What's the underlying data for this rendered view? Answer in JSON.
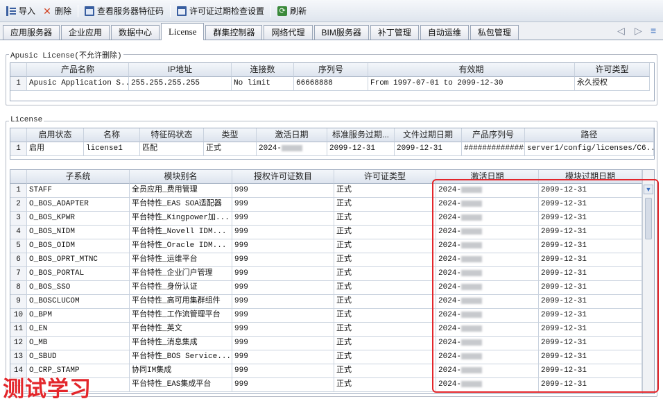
{
  "toolbar": {
    "import": "导入",
    "delete": "删除",
    "view_code": "查看服务器特征码",
    "license_check": "许可证过期检查设置",
    "refresh": "刷新"
  },
  "tabs": [
    "应用服务器",
    "企业应用",
    "数据中心",
    "License",
    "群集控制器",
    "网络代理",
    "BIM服务器",
    "补丁管理",
    "自动运维",
    "私包管理"
  ],
  "tab_nav": {
    "prev": "◁",
    "next": "▷",
    "menu": "≡"
  },
  "apusic": {
    "group_title": "Apusic License(不允许删除)",
    "headers": [
      "产品名称",
      "IP地址",
      "连接数",
      "序列号",
      "有效期",
      "许可类型"
    ],
    "rows": [
      [
        "1",
        "Apusic Application S...",
        "255.255.255.255",
        "No limit",
        "66668888",
        "From 1997-07-01  to 2099-12-30",
        "永久授权"
      ]
    ]
  },
  "license": {
    "group_title": "License",
    "headers": [
      "启用状态",
      "名称",
      "特征码状态",
      "类型",
      "激活日期",
      "标准服务过期...",
      "文件过期日期",
      "产品序列号",
      "路径"
    ],
    "rows": [
      [
        "1",
        "启用",
        "license1",
        "匹配",
        "正式",
        "2024-",
        "2099-12-31",
        "2099-12-31",
        "##############",
        "server1/config/licenses/C6..."
      ]
    ]
  },
  "modules": {
    "headers": [
      "子系统",
      "模块别名",
      "授权许可证数目",
      "许可证类型",
      "激活日期",
      "模块过期日期"
    ],
    "rows": [
      [
        "1",
        "STAFF",
        "全员应用_费用管理",
        "999",
        "正式",
        "2024-",
        "2099-12-31"
      ],
      [
        "2",
        "O_BOS_ADAPTER",
        "平台特性_EAS SOA适配器",
        "999",
        "正式",
        "2024-",
        "2099-12-31"
      ],
      [
        "3",
        "O_BOS_KPWR",
        "平台特性_Kingpower加...",
        "999",
        "正式",
        "2024-",
        "2099-12-31"
      ],
      [
        "4",
        "O_BOS_NIDM",
        "平台特性_Novell IDM...",
        "999",
        "正式",
        "2024-",
        "2099-12-31"
      ],
      [
        "5",
        "O_BOS_OIDM",
        "平台特性_Oracle IDM...",
        "999",
        "正式",
        "2024-",
        "2099-12-31"
      ],
      [
        "6",
        "O_BOS_OPRT_MTNC",
        "平台特性_运维平台",
        "999",
        "正式",
        "2024-",
        "2099-12-31"
      ],
      [
        "7",
        "O_BOS_PORTAL",
        "平台特性_企业门户管理",
        "999",
        "正式",
        "2024-",
        "2099-12-31"
      ],
      [
        "8",
        "O_BOS_SSO",
        "平台特性_身份认证",
        "999",
        "正式",
        "2024-",
        "2099-12-31"
      ],
      [
        "9",
        "O_BOSCLUCOM",
        "平台特性_高可用集群组件",
        "999",
        "正式",
        "2024-",
        "2099-12-31"
      ],
      [
        "10",
        "O_BPM",
        "平台特性_工作流管理平台",
        "999",
        "正式",
        "2024-",
        "2099-12-31"
      ],
      [
        "11",
        "O_EN",
        "平台特性_英文",
        "999",
        "正式",
        "2024-",
        "2099-12-31"
      ],
      [
        "12",
        "O_MB",
        "平台特性_消息集成",
        "999",
        "正式",
        "2024-",
        "2099-12-31"
      ],
      [
        "13",
        "O_SBUD",
        "平台特性_BOS Service...",
        "999",
        "正式",
        "2024-",
        "2099-12-31"
      ],
      [
        "14",
        "O_CRP_STAMP",
        "协同IM集成",
        "999",
        "正式",
        "2024-",
        "2099-12-31"
      ],
      [
        "15",
        "",
        "平台特性_EAS集成平台",
        "999",
        "正式",
        "2024-",
        "2099-12-31"
      ]
    ]
  },
  "watermark": "测试学习"
}
